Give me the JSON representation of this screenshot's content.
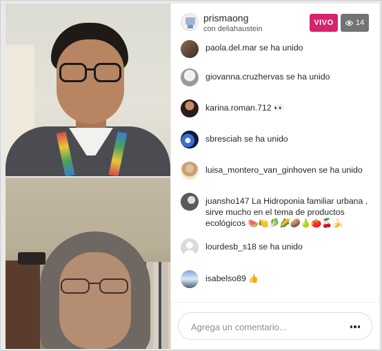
{
  "header": {
    "host_username": "prismaong",
    "host_subtitle": "con deliahaustein",
    "live_label": "VIVO",
    "viewer_count": "14",
    "live_color": "#d5246d",
    "viewer_badge_color": "#737373",
    "viewer_icon": "eye-icon"
  },
  "comments": [
    {
      "user": "paola.del.mar",
      "text": "se ha unido"
    },
    {
      "user": "giovanna.cruzhervas",
      "text": "se ha unido"
    },
    {
      "user": "karina.roman.712",
      "text": "👀"
    },
    {
      "user": "sbresciah",
      "text": "se ha unido"
    },
    {
      "user": "luisa_montero_van_ginhoven",
      "text": "se ha unido"
    },
    {
      "user": "juansho147",
      "text": "La Hidroponia familiar urbana , sirve mucho en el tema de productos ecológicos 🍉🍋🥬🌽🥔🍐🍅🍒🍌"
    },
    {
      "user": "lourdesb_s18",
      "text": "se ha unido"
    },
    {
      "user": "isabelso89",
      "text": "👍"
    }
  ],
  "composer": {
    "placeholder": "Agrega un comentario...",
    "more_icon": "more-options-icon"
  }
}
